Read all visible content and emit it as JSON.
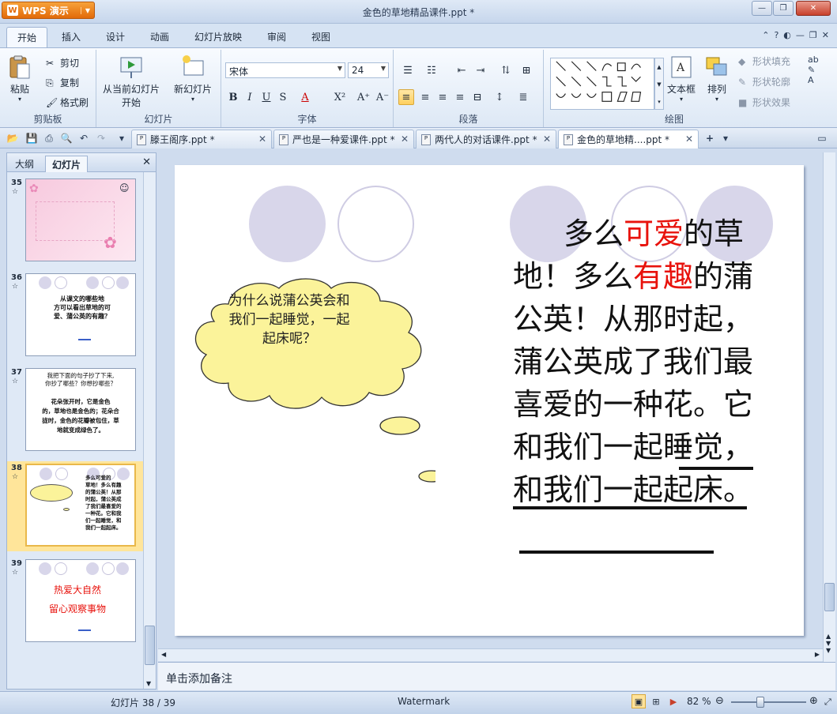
{
  "app": {
    "name": "WPS 演示",
    "window_title": "金色的草地精品课件.ppt *"
  },
  "ribbon_tabs": [
    "开始",
    "插入",
    "设计",
    "动画",
    "幻灯片放映",
    "审阅",
    "视图"
  ],
  "ribbon": {
    "clipboard": {
      "paste": "粘贴",
      "cut": "剪切",
      "copy": "复制",
      "format_painter": "格式刷",
      "label": "剪贴板"
    },
    "slides": {
      "from_current_line1": "从当前幻灯片",
      "from_current_line2": "开始",
      "new_slide": "新幻灯片",
      "label": "幻灯片"
    },
    "font": {
      "family": "宋体",
      "size": "24",
      "label": "字体"
    },
    "paragraph": {
      "label": "段落"
    },
    "drawing": {
      "textbox": "文本框",
      "arrange": "排列",
      "shape_fill": "形状填充",
      "shape_outline": "形状轮廓",
      "shape_effect": "形状效果",
      "label": "绘图"
    }
  },
  "doc_tabs": [
    {
      "label": "滕王阁序.ppt *"
    },
    {
      "label": "严也是一种爱课件.ppt *"
    },
    {
      "label": "两代人的对话课件.ppt *"
    },
    {
      "label": "金色的草地精....ppt *"
    }
  ],
  "left_pane": {
    "tab_outline": "大纲",
    "tab_slides": "幻灯片",
    "thumbnails": [
      {
        "num": "35",
        "lines": []
      },
      {
        "num": "36",
        "lines": [
          "从课文的哪些地",
          "方可以看出草地的可",
          "爱、蒲公英的有趣？"
        ]
      },
      {
        "num": "37",
        "lines": [
          "我把下面的句子抄了下来,",
          "你抄了哪些？你想抄哪些？",
          "花朵张开时，它是金色",
          "的，草地也是金色的；花朵合",
          "拢时，金色的花瓣被包住，草",
          "地就变成绿色了。"
        ]
      },
      {
        "num": "38",
        "lines": [
          "多么可爱的",
          "草地！多么有趣",
          "的蒲公英！从那",
          "时起，蒲公英成",
          "了我们最喜爱的",
          "一种花。它和我",
          "们一起睡觉，和",
          "我们一起起床。"
        ]
      },
      {
        "num": "39",
        "lines": [
          "热爱大自然",
          "留心观察事物"
        ]
      }
    ]
  },
  "slide": {
    "cloud_text": "为什么说蒲公英会和我们一起睡觉，一起起床呢？",
    "main": {
      "p1": "多么",
      "p1_red": "可爱",
      "p2": "的草地！多么",
      "p2_red": "有趣",
      "p3": "的蒲公英！从那时起，蒲公英成了我们最喜爱的一种花。它和我们一起睡觉，和我们一起起床。"
    }
  },
  "notes_placeholder": "单击添加备注",
  "status": {
    "slide_counter": "幻灯片 38 / 39",
    "watermark": "Watermark",
    "zoom": "82 %"
  },
  "colors": {
    "accent_red": "#e8120c",
    "cloud_fill": "#fbf39a",
    "circle_fill": "#d8d6ea"
  }
}
